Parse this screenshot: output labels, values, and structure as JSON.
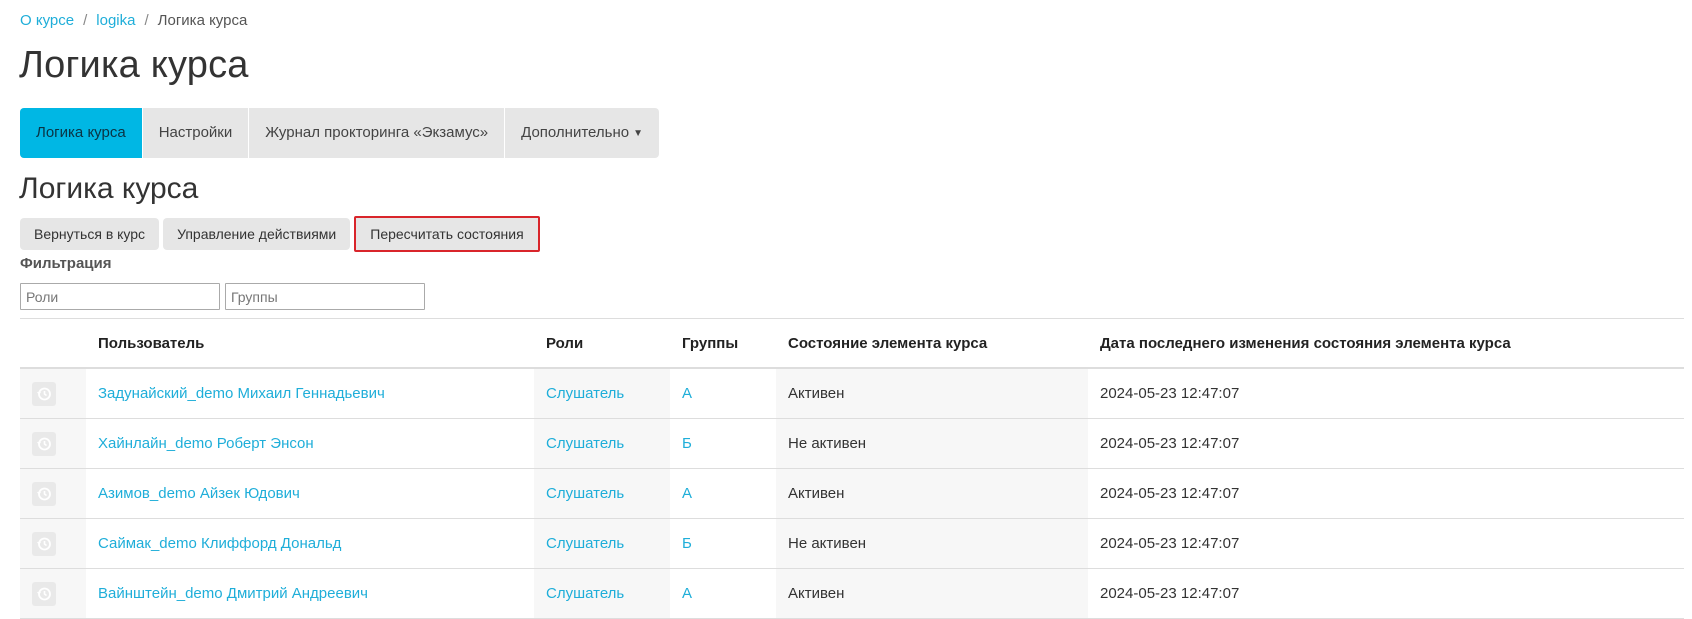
{
  "breadcrumb": {
    "items": [
      "О курсе",
      "logika",
      "Логика курса"
    ],
    "separator": "/"
  },
  "page_title": "Логика курса",
  "tabs": [
    {
      "label": "Логика курса",
      "active": true
    },
    {
      "label": "Настройки"
    },
    {
      "label": "Журнал прокторинга «Экзамус»"
    },
    {
      "label": "Дополнительно"
    }
  ],
  "section_title": "Логика курса",
  "actions": {
    "back": "Вернуться в курс",
    "manage": "Управление действиями",
    "recalc": "Пересчитать состояния"
  },
  "filter": {
    "label": "Фильтрация",
    "roles_placeholder": "Роли",
    "groups_placeholder": "Группы"
  },
  "table": {
    "headers": [
      "",
      "Пользователь",
      "Роли",
      "Группы",
      "Состояние элемента курса",
      "Дата последнего изменения состояния элемента курса"
    ],
    "rows": [
      {
        "icon": "history-icon",
        "user": "Задунайский_demo Михаил Геннадьевич",
        "role": "Слушатель",
        "group": "А",
        "state": "Активен",
        "date": "2024-05-23 12:47:07"
      },
      {
        "icon": "history-icon",
        "user": "Хайнлайн_demo Роберт Энсон",
        "role": "Слушатель",
        "group": "Б",
        "state": "Не активен",
        "date": "2024-05-23 12:47:07"
      },
      {
        "icon": "history-icon",
        "user": "Азимов_demo Айзек Юдович",
        "role": "Слушатель",
        "group": "А",
        "state": "Активен",
        "date": "2024-05-23 12:47:07"
      },
      {
        "icon": "history-icon",
        "user": "Саймак_demo Клиффорд Дональд",
        "role": "Слушатель",
        "group": "Б",
        "state": "Не активен",
        "date": "2024-05-23 12:47:07"
      },
      {
        "icon": "history-icon",
        "user": "Вайнштейн_demo Дмитрий Андреевич",
        "role": "Слушатель",
        "group": "А",
        "state": "Активен",
        "date": "2024-05-23 12:47:07"
      }
    ]
  },
  "colors": {
    "accent": "#00b7e4",
    "link": "#1faed9",
    "highlight_border": "#d9252b"
  }
}
